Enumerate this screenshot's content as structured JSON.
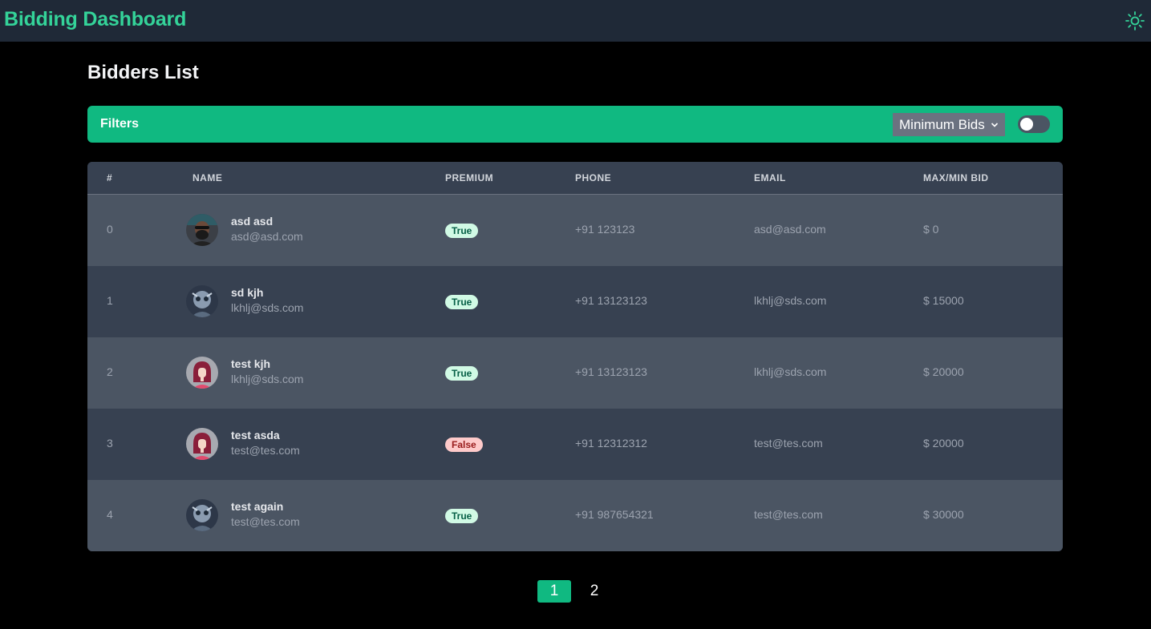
{
  "app": {
    "title": "Bidding Dashboard"
  },
  "page": {
    "title": "Bidders List"
  },
  "filters": {
    "label": "Filters",
    "select_value": "Minimum Bids",
    "toggle_on": false
  },
  "table": {
    "headers": [
      "#",
      "NAME",
      "PREMIUM",
      "PHONE",
      "EMAIL",
      "MAX/MIN BID"
    ],
    "rows": [
      {
        "index": "0",
        "name": "asd asd",
        "sub_email": "asd@asd.com",
        "premium": "True",
        "phone": "+91 123123",
        "email": "asd@asd.com",
        "bid": "$ 0",
        "avatar": "avatar-man-beard"
      },
      {
        "index": "1",
        "name": "sd kjh",
        "sub_email": "lkhlj@sds.com",
        "premium": "True",
        "phone": "+91 13123123",
        "email": "lkhlj@sds.com",
        "bid": "$ 15000",
        "avatar": "avatar-robot"
      },
      {
        "index": "2",
        "name": "test kjh",
        "sub_email": "lkhlj@sds.com",
        "premium": "True",
        "phone": "+91 13123123",
        "email": "lkhlj@sds.com",
        "bid": "$ 20000",
        "avatar": "avatar-woman"
      },
      {
        "index": "3",
        "name": "test asda",
        "sub_email": "test@tes.com",
        "premium": "False",
        "phone": "+91 12312312",
        "email": "test@tes.com",
        "bid": "$ 20000",
        "avatar": "avatar-woman"
      },
      {
        "index": "4",
        "name": "test again",
        "sub_email": "test@tes.com",
        "premium": "True",
        "phone": "+91 987654321",
        "email": "test@tes.com",
        "bid": "$ 30000",
        "avatar": "avatar-robot"
      }
    ]
  },
  "pagination": {
    "pages": [
      "1",
      "2"
    ],
    "current": "1"
  },
  "colors": {
    "brand": "#34d399",
    "accent": "#10b981",
    "topbar": "#1f2937",
    "row_light": "#4b5563",
    "row_dark": "#374151",
    "badge_true_bg": "#d1fae5",
    "badge_false_bg": "#fecaca"
  },
  "icons": {
    "theme_toggle": "sun-icon",
    "select_arrow": "chevron-down-icon"
  }
}
